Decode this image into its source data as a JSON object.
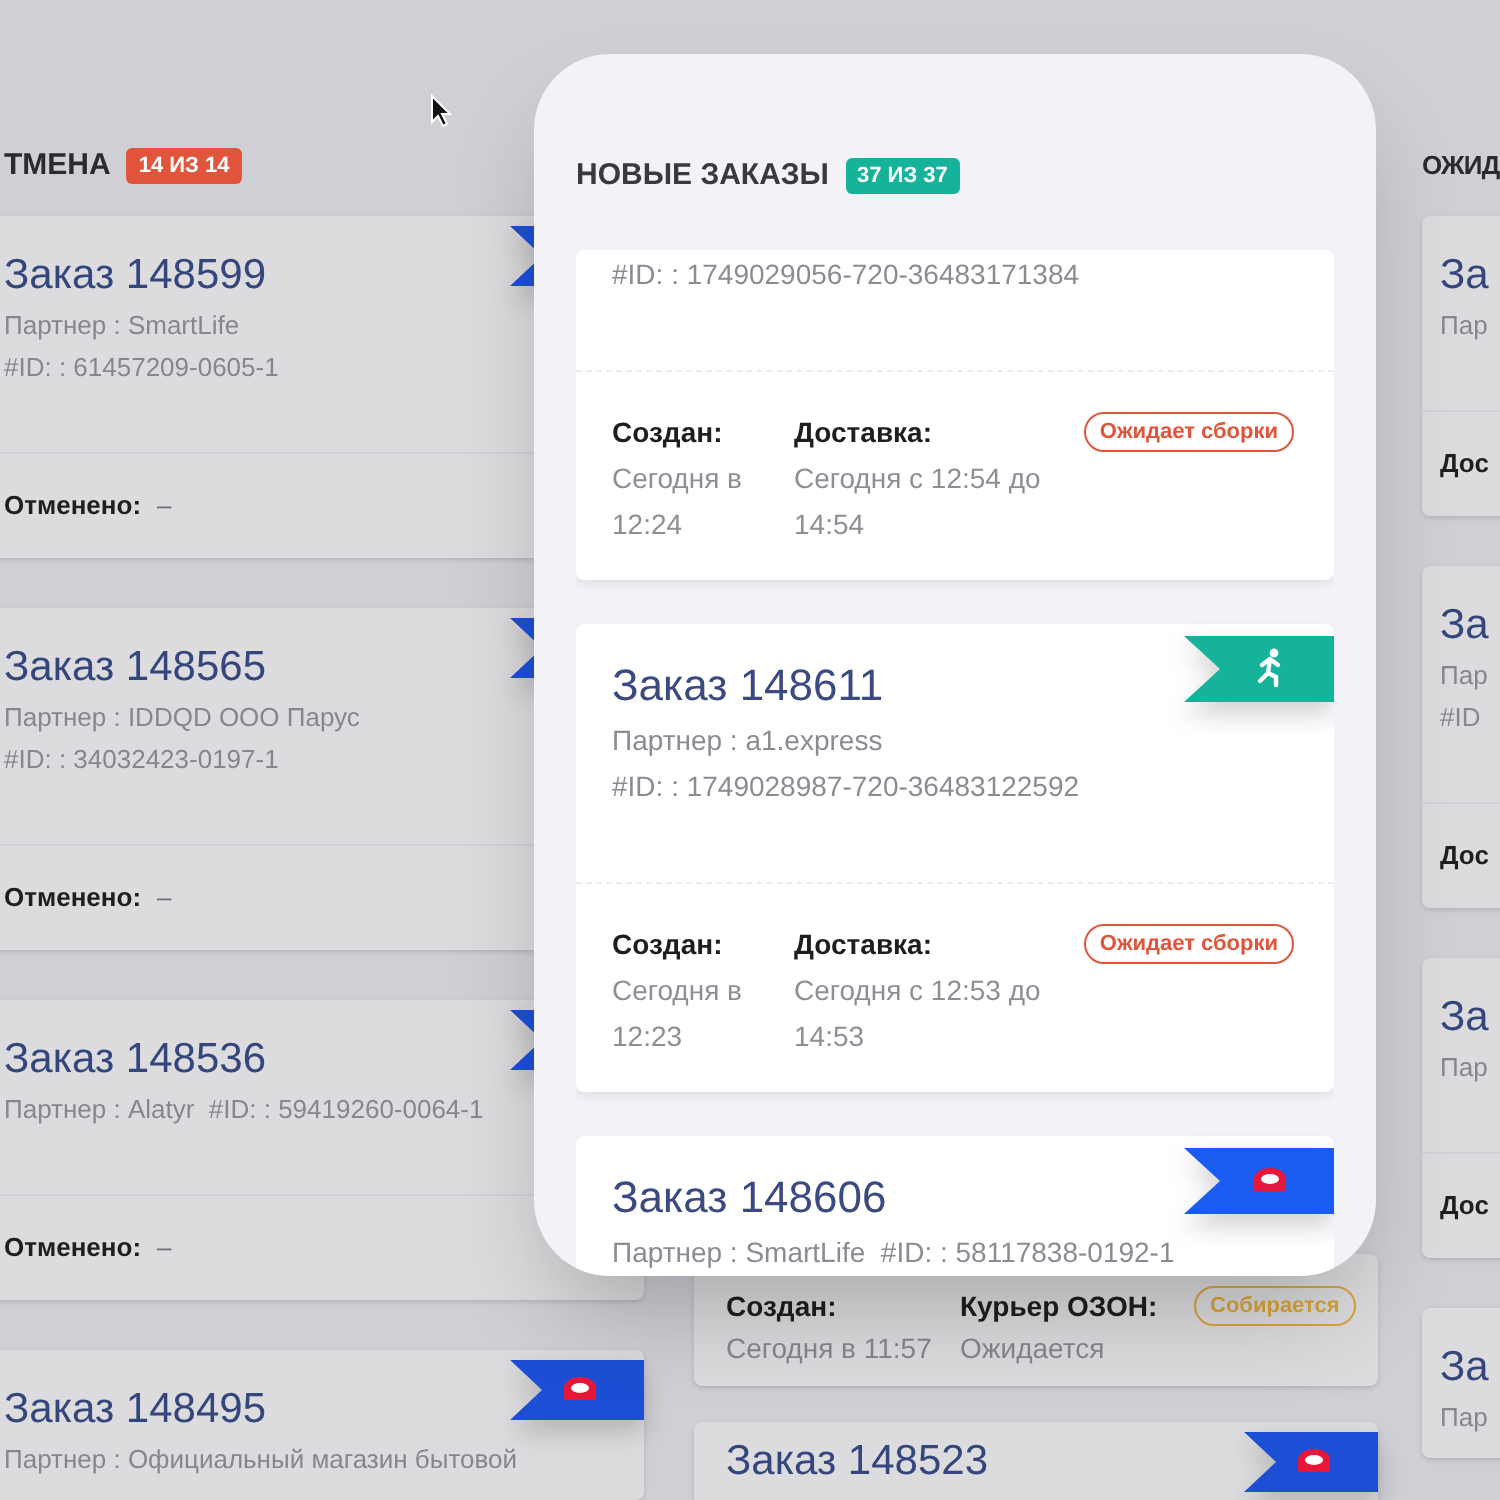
{
  "board": {
    "columns": [
      {
        "title": "ТМЕНА",
        "count": "14 ИЗ 14",
        "color": "#e0553c",
        "cards": [
          {
            "title": "Заказ 148599",
            "lines": [
              "Партнер : SmartLife",
              "#ID: : 61457209-0605-1"
            ],
            "ribbon": {
              "kind": "flag"
            },
            "footer": {
              "kind": "inline",
              "fields": [
                {
                  "label": "Отменено:",
                  "value": "–"
                }
              ]
            }
          },
          {
            "title": "Заказ 148565",
            "lines": [
              "Партнер : IDDQD ООО Парус",
              "#ID: : 34032423-0197-1"
            ],
            "ribbon": {
              "kind": "flag"
            },
            "footer": {
              "kind": "inline",
              "fields": [
                {
                  "label": "Отменено:",
                  "value": "–"
                }
              ]
            }
          },
          {
            "title": "Заказ 148536",
            "lines": [
              "Партнер : Alatyr  #ID: : 59419260-0064-1"
            ],
            "ribbon": {
              "kind": "flag"
            },
            "footer": {
              "kind": "inline",
              "fields": [
                {
                  "label": "Отменено:",
                  "value": "–"
                }
              ]
            }
          },
          {
            "title": "Заказ 148495",
            "lines": [
              "Партнер : Официальный магазин бытовой"
            ],
            "ribbon": {
              "kind": "ozon"
            }
          }
        ]
      },
      {
        "cards": [
          {
            "footer": {
              "kind": "stacked",
              "fields": [
                {
                  "label": "Создан:",
                  "value": "Сегодня в 11:57"
                },
                {
                  "label": "Курьер ОЗОН:",
                  "value": "Ожидается"
                }
              ],
              "status": {
                "text": "Собирается",
                "color": "#d9a63a"
              }
            }
          },
          {
            "title": "Заказ 148523",
            "ribbon": {
              "kind": "ozon"
            }
          }
        ]
      },
      {
        "title": "ОЖИД",
        "cards": [
          {
            "title": "За",
            "lines": [
              "Пар"
            ],
            "footer": {
              "kind": "inline",
              "fields": [
                {
                  "label": "Дос"
                }
              ]
            }
          },
          {
            "title": "За",
            "lines": [
              "Пар",
              "#ID"
            ],
            "footer": {
              "kind": "inline",
              "fields": [
                {
                  "label": "Дос"
                }
              ]
            }
          },
          {
            "title": "За",
            "lines": [
              "Пар"
            ],
            "footer": {
              "kind": "inline",
              "fields": [
                {
                  "label": "Дос"
                }
              ]
            }
          },
          {
            "title": "За",
            "lines": [
              "Пар"
            ]
          }
        ]
      }
    ]
  },
  "focus_panel": {
    "title": "НОВЫЕ ЗАКАЗЫ",
    "count": "37 ИЗ 37",
    "color": "#14b39a",
    "cards": [
      {
        "lines": [
          "#ID: : 1749029056-720-36483171384"
        ],
        "footer": {
          "kind": "stacked",
          "fields": [
            {
              "label": "Создан:",
              "value": "Сегодня в 12:24"
            },
            {
              "label": "Доставка:",
              "value": "Сегодня с 12:54 до 14:54"
            }
          ],
          "status": {
            "text": "Ожидает сборки",
            "color": "#e0553c"
          }
        }
      },
      {
        "title": "Заказ 148611",
        "lines": [
          "Партнер : a1.express",
          "#ID: : 1749028987-720-36483122592"
        ],
        "ribbon": {
          "kind": "courier"
        },
        "footer": {
          "kind": "stacked",
          "fields": [
            {
              "label": "Создан:",
              "value": "Сегодня в 12:23"
            },
            {
              "label": "Доставка:",
              "value": "Сегодня с 12:53 до 14:53"
            }
          ],
          "status": {
            "text": "Ожидает сборки",
            "color": "#e0553c"
          }
        }
      },
      {
        "title": "Заказ 148606",
        "lines": [
          "Партнер : SmartLife  #ID: : 58117838-0192-1"
        ],
        "ribbon": {
          "kind": "ozon"
        }
      }
    ]
  }
}
